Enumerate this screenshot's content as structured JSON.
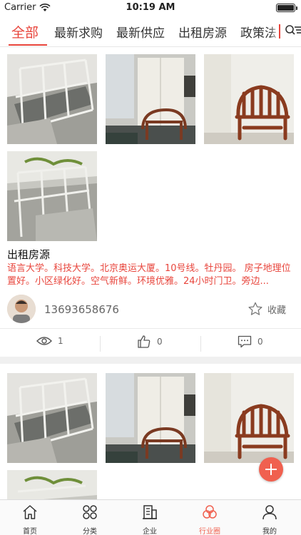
{
  "status_bar": {
    "carrier": "Carrier",
    "time": "10:19 AM"
  },
  "tabs": [
    {
      "label": "全部",
      "active": true
    },
    {
      "label": "最新求购",
      "active": false
    },
    {
      "label": "最新供应",
      "active": false
    },
    {
      "label": "出租房源",
      "active": false
    },
    {
      "label": "政策法",
      "active": false
    }
  ],
  "posts": [
    {
      "title": "出租房源",
      "description": "语言大学。科技大学。北京奥运大厦。10号线。牡丹园。 房子地理位置好。小区绿化好。空气新鲜。环境优雅。24小时门卫。旁边...",
      "phone": "13693658676",
      "favorite_label": "收藏",
      "views": "1",
      "likes": "0",
      "comments": "0"
    },
    {
      "title": "",
      "description": "",
      "phone": "",
      "favorite_label": "",
      "views": "",
      "likes": "",
      "comments": ""
    }
  ],
  "bottom_nav": [
    {
      "label": "首页",
      "icon": "home-icon",
      "active": false
    },
    {
      "label": "分类",
      "icon": "category-icon",
      "active": false
    },
    {
      "label": "企业",
      "icon": "building-icon",
      "active": false
    },
    {
      "label": "行业圈",
      "icon": "circles-icon",
      "active": true
    },
    {
      "label": "我的",
      "icon": "profile-icon",
      "active": false
    }
  ],
  "colors": {
    "accent": "#e8453c",
    "fab": "#f0604f"
  }
}
